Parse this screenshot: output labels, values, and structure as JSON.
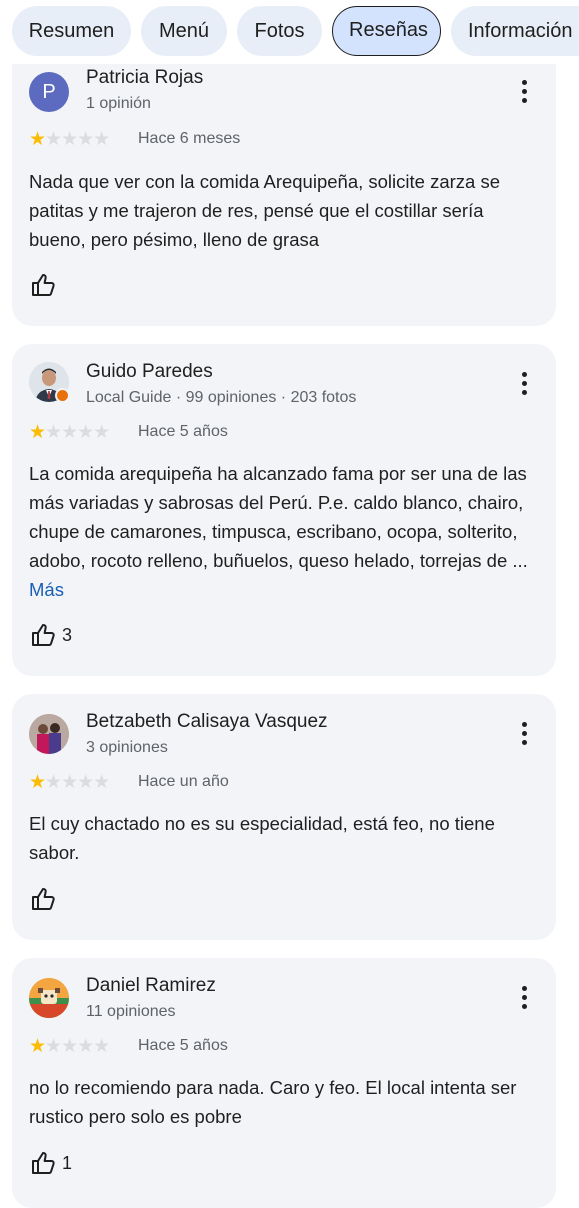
{
  "tabs": [
    "Resumen",
    "Menú",
    "Fotos",
    "Reseñas",
    "Información"
  ],
  "more_label": "Más",
  "reviews": [
    {
      "name": "Patricia Rojas",
      "meta": "1 opinión",
      "avatar_letter": "P",
      "rating": 1,
      "time": "Hace 6 meses",
      "text": "Nada que ver con la comida Arequipeña, solicite zarza se patitas y me trajeron de res, pensé que el costillar sería bueno, pero pésimo, lleno de grasa",
      "likes": ""
    },
    {
      "name": "Guido Paredes",
      "meta": "Local Guide · 99 opiniones · 203 fotos",
      "rating": 1,
      "time": "Hace 5 años",
      "text": "La comida arequipeña ha alcanzado fama por ser una de las más variadas y sabrosas del Perú. P.e. caldo blanco, chairo, chupe de camarones, timpusca, escribano, ocopa, solterito, adobo, rocoto relleno, buñuelos, queso helado, torrejas de ...",
      "likes": "3"
    },
    {
      "name": "Betzabeth Calisaya Vasquez",
      "meta": "3 opiniones",
      "rating": 1,
      "time": "Hace un año",
      "text": "El cuy chactado no es su especialidad, está feo, no tiene sabor.",
      "likes": ""
    },
    {
      "name": "Daniel Ramirez",
      "meta": "11 opiniones",
      "rating": 1,
      "time": "Hace 5 años",
      "text": "no lo recomiendo para nada. Caro y feo. El local intenta ser rustico pero solo es pobre",
      "likes": "1"
    }
  ],
  "colors": {
    "star": "#fbbc04",
    "accent": "#1a5fb4",
    "avatar_p": "#5c6bc0"
  }
}
